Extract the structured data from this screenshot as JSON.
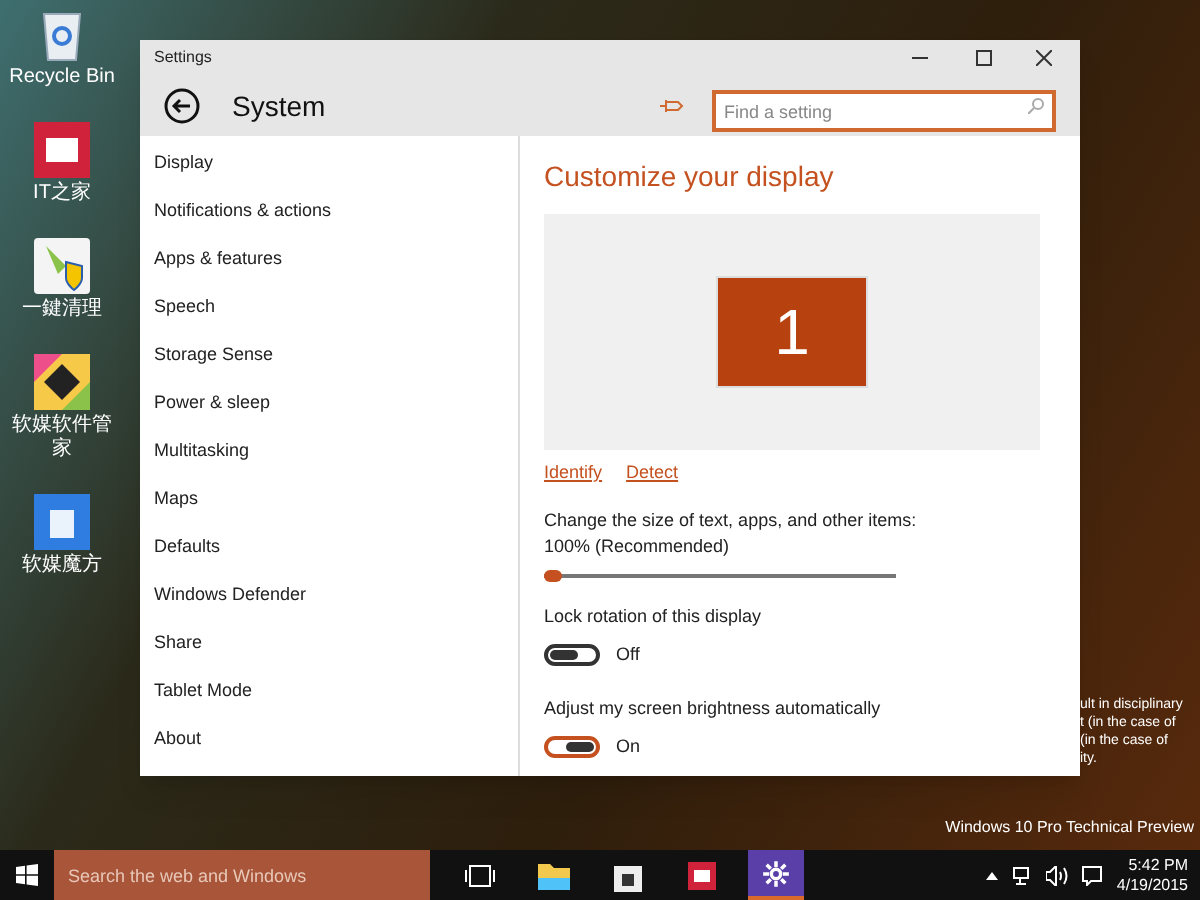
{
  "desktop_icons": [
    {
      "kind": "recycle",
      "label": "Recycle Bin"
    },
    {
      "kind": "it",
      "label": "IT之家"
    },
    {
      "kind": "cleaner",
      "label": "一鍵清理"
    },
    {
      "kind": "manager",
      "label": "软媒软件管家"
    },
    {
      "kind": "cube",
      "label": "软媒魔方"
    }
  ],
  "desktop_text": [
    "ult in disciplinary",
    "t (in the case of",
    "(in the case of",
    "ity."
  ],
  "watermark_os": "Windows 10 Pro Technical Preview",
  "window": {
    "title": "Settings",
    "header": "System",
    "search": {
      "placeholder": "Find a setting"
    }
  },
  "sidebar": {
    "items": [
      {
        "label": "Display"
      },
      {
        "label": "Notifications & actions"
      },
      {
        "label": "Apps & features"
      },
      {
        "label": "Speech"
      },
      {
        "label": "Storage Sense"
      },
      {
        "label": "Power & sleep"
      },
      {
        "label": "Multitasking"
      },
      {
        "label": "Maps"
      },
      {
        "label": "Defaults"
      },
      {
        "label": "Windows Defender"
      },
      {
        "label": "Share"
      },
      {
        "label": "Tablet Mode"
      },
      {
        "label": "About"
      }
    ]
  },
  "content": {
    "heading": "Customize your display",
    "monitor": "1",
    "links": [
      "Identify",
      "Detect"
    ],
    "scale": {
      "label": "Change the size of text, apps, and other items: 100% (Recommended)",
      "level": 0.05
    },
    "toggles": [
      {
        "label": "Lock rotation of this display",
        "on": false,
        "state_text": "Off"
      },
      {
        "label": "Adjust my screen brightness automatically",
        "on": true,
        "state_text": "On"
      }
    ]
  },
  "taskbar": {
    "search": {
      "placeholder": "Search the web and Windows"
    },
    "apps": [
      {
        "kind": "taskview",
        "active": false
      },
      {
        "kind": "folder",
        "active": false
      },
      {
        "kind": "store",
        "active": false
      },
      {
        "kind": "it",
        "active": false
      },
      {
        "kind": "settings",
        "active": true
      }
    ],
    "time": "5:42 PM",
    "date": "4/19/2015"
  }
}
